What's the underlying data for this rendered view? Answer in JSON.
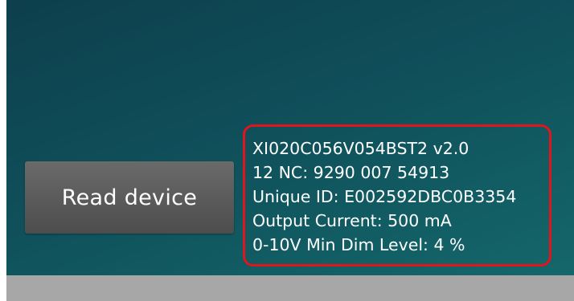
{
  "actions": {
    "read_device_label": "Read device"
  },
  "device_info": {
    "lines": [
      "XI020C056V054BST2 v2.0",
      "12 NC: 9290 007 54913",
      "Unique ID: E002592DBC0B3354",
      "Output Current: 500 mA",
      "0-10V Min Dim Level: 4 %"
    ]
  },
  "colors": {
    "panel_gradient_start": "#0d3f4c",
    "panel_gradient_end": "#14676b",
    "button_background": "#5a5a5a",
    "highlight_border": "#e0151d",
    "status_strip": "#a7a7a7"
  }
}
